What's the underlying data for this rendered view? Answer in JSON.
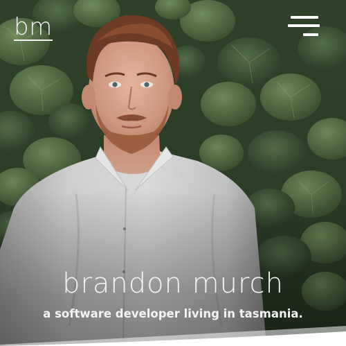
{
  "header": {
    "logo_text": "bm",
    "menu_icon": "hamburger-menu-icon"
  },
  "hero": {
    "name": "brandon murch",
    "tagline": "a software developer living in tasmania.",
    "photo": "portrait-photo-man-in-white-shirt-ivy-background"
  },
  "colors": {
    "text": "#f4f4f4",
    "foliage_dark": "#2d3e27",
    "foliage_light": "#5f7a4f",
    "shirt": "#dcdcdc",
    "page_bottom": "#ffffff"
  }
}
